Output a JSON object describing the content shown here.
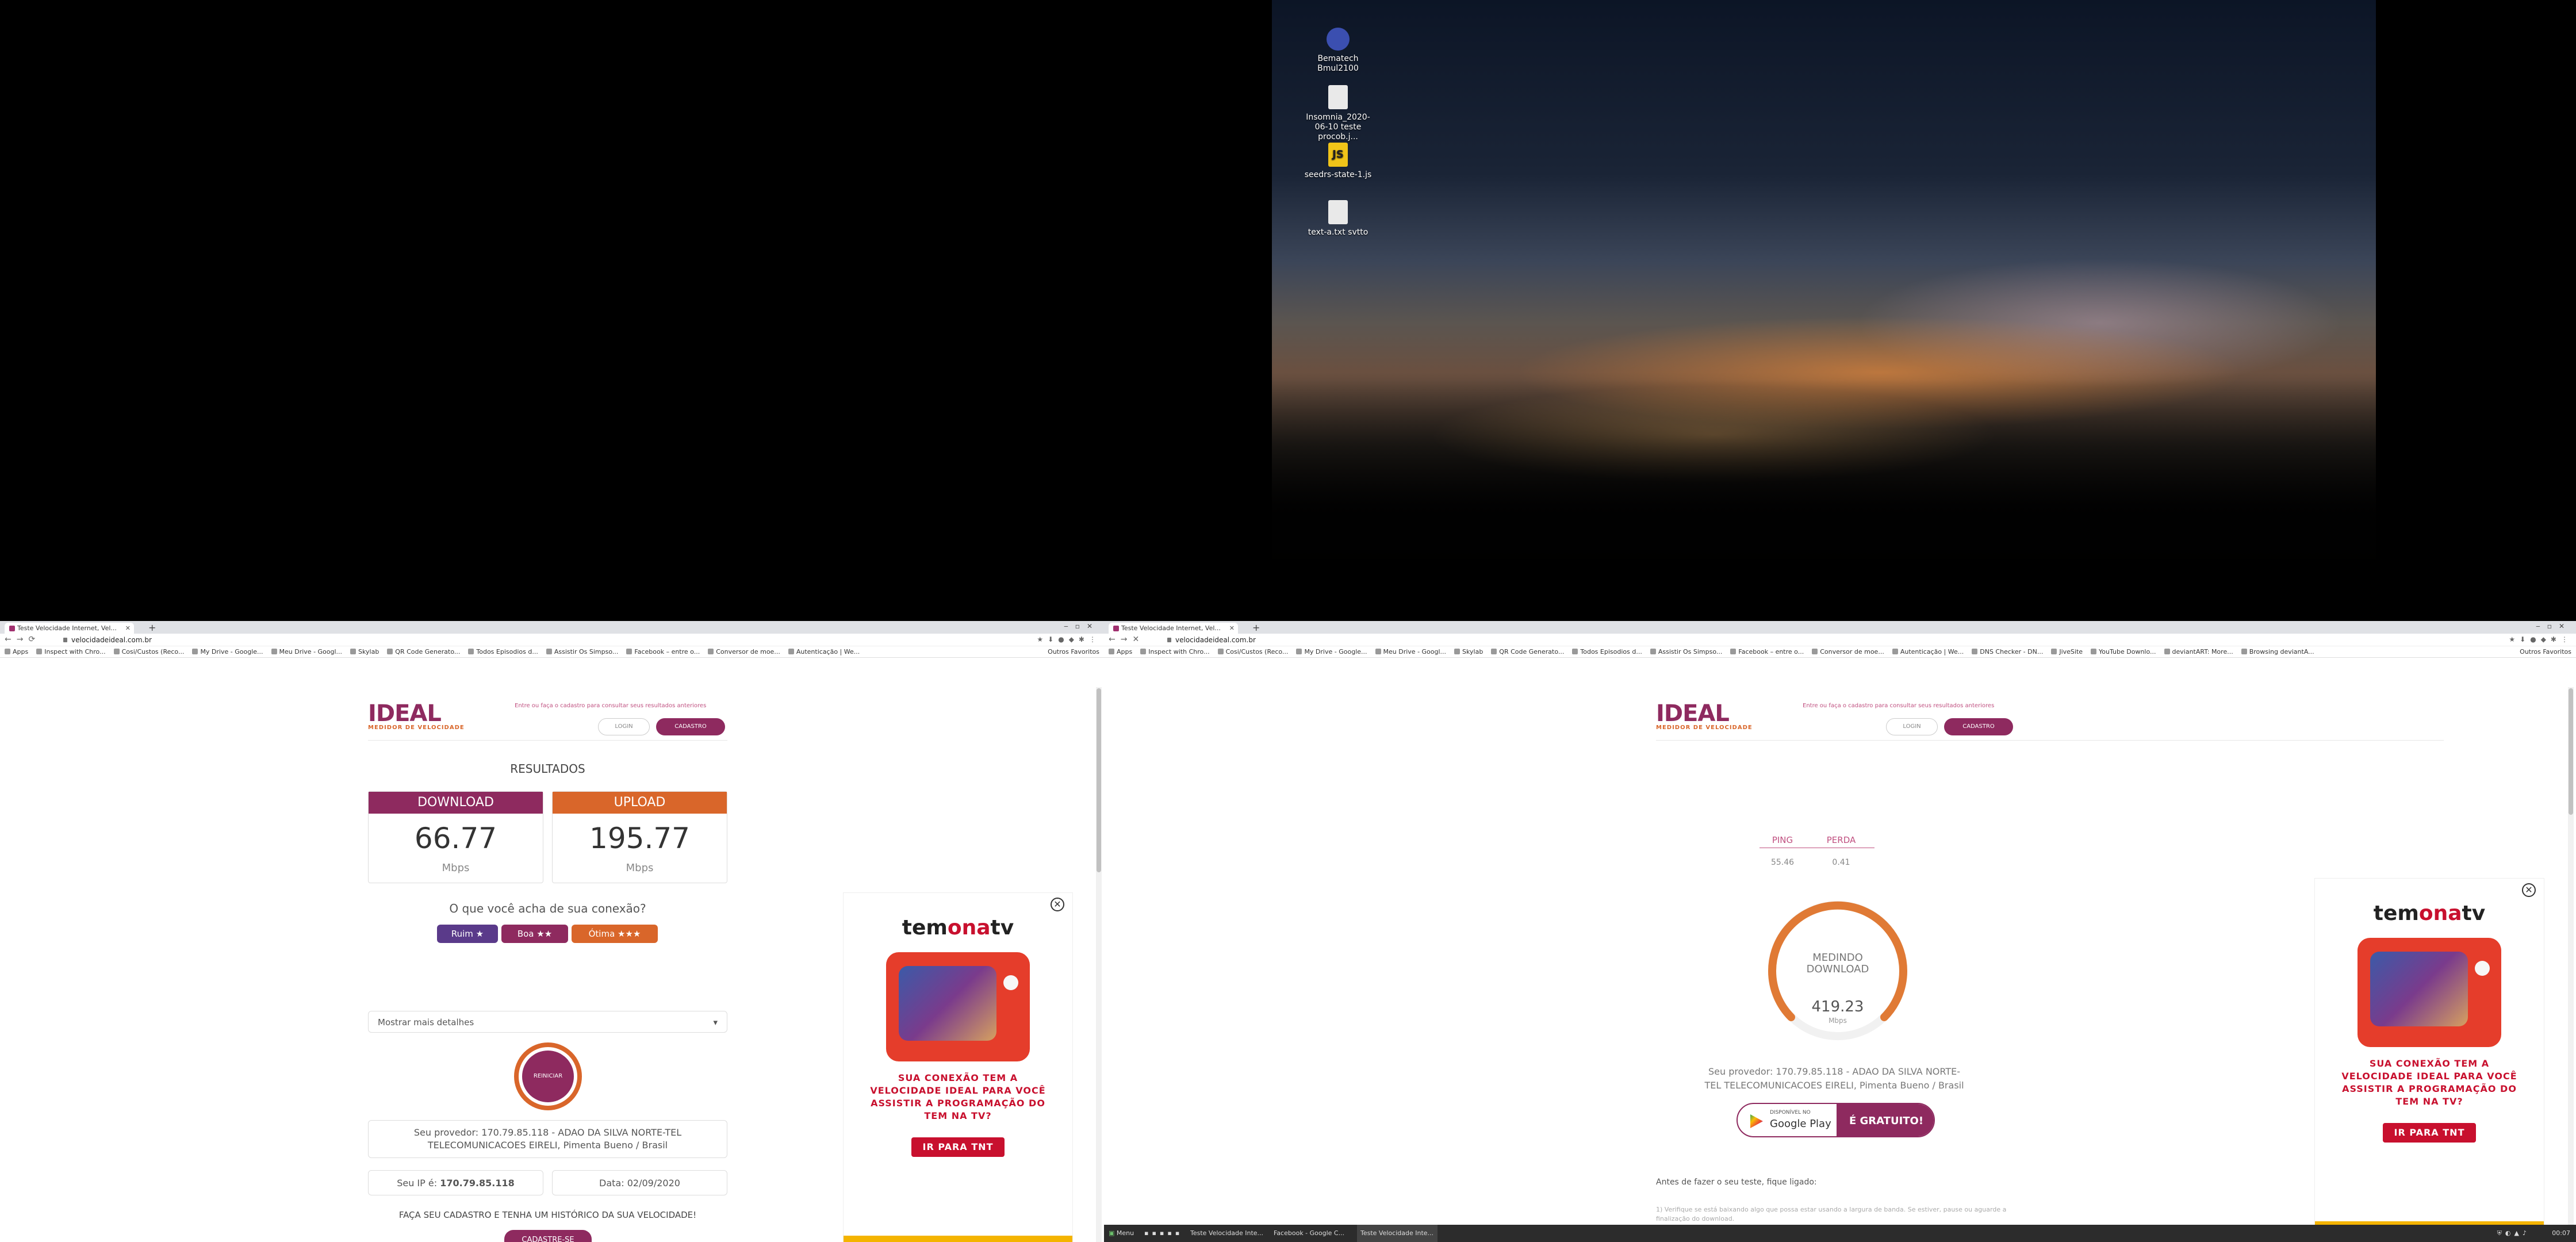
{
  "desktop": {
    "icons": [
      {
        "label": "Bematech Bmul2100",
        "glyph": "printer-icon"
      },
      {
        "label": "Insomnia_2020-06-10 teste procob.j...",
        "glyph": "file-icon"
      },
      {
        "label": "seedrs-state-1.js",
        "glyph": "js-file-icon"
      },
      {
        "label": "text-a.txt svtto",
        "glyph": "text-file-icon"
      }
    ]
  },
  "browser_left": {
    "tab_title": "Teste Velocidade Internet, Vel...",
    "url": "velocidadeideal.com.br",
    "bookmarks": [
      "Apps",
      "Inspect with Chro...",
      "Cosi/Custos (Reco...",
      "My Drive - Google...",
      "Meu Drive - Googl...",
      "Skylab",
      "QR Code Generato...",
      "Todos Episodios d...",
      "Assistir Os Simpso...",
      "Facebook – entre o...",
      "Conversor de moe...",
      "Autenticação | We..."
    ],
    "other_bookmarks": "Outros Favoritos"
  },
  "browser_right": {
    "tab_title": "Teste Velocidade Internet, Vel...",
    "url": "velocidadeideal.com.br",
    "bookmarks": [
      "Apps",
      "Inspect with Chro...",
      "Cosi/Custos (Reco...",
      "My Drive - Google...",
      "Meu Drive - Googl...",
      "Skylab",
      "QR Code Generato...",
      "Todos Episodios d...",
      "Assistir Os Simpso...",
      "Facebook – entre o...",
      "Conversor de moe...",
      "Autenticação | We...",
      "DNS Checker - DN...",
      "JiveSite",
      "YouTube Downlo...",
      "deviantART: More...",
      "Browsing deviantA..."
    ],
    "other_bookmarks": "Outros Favoritos"
  },
  "site": {
    "logo": "IDEAL",
    "logo_sub": "MEDIDOR DE VELOCIDADE",
    "header_note": "Entre ou faça o cadastro para consultar seus resultados anteriores",
    "login": "LOGIN",
    "signup": "CADASTRO"
  },
  "results": {
    "title": "RESULTADOS",
    "download_label": "DOWNLOAD",
    "download_value": "66.77",
    "upload_label": "UPLOAD",
    "upload_value": "195.77",
    "unit": "Mbps",
    "question": "O que você acha de sua conexão?",
    "rate_bad": "Ruim ★",
    "rate_good": "Boa ★★",
    "rate_great": "Ótima ★★★",
    "details": "Mostrar mais detalhes",
    "restart": "REINICIAR",
    "provider": "Seu provedor: 170.79.85.118 - ADAO DA SILVA NORTE-TEL TELECOMUNICACOES EIRELI, Pimenta Bueno / Brasil",
    "ip_label": "Seu IP é:",
    "ip": "170.79.85.118",
    "date": "Data: 02/09/2020",
    "cta_text": "FAÇA SEU CADASTRO E TENHA UM HISTÓRICO DA SUA VELOCIDADE!",
    "cta_button": "CADASTRE-SE"
  },
  "measuring": {
    "ping_label": "PING",
    "ping_value": "55.46",
    "loss_label": "PERDA",
    "loss_value": "0.41",
    "status_line1": "MEDINDO",
    "status_line2": "DOWNLOAD",
    "speed": "419.23",
    "unit": "Mbps",
    "provider": "Seu provedor: 170.79.85.118 - ADAO DA SILVA NORTE-TEL TELECOMUNICACOES EIRELI, Pimenta Bueno / Brasil",
    "gplay_small": "DISPONÍVEL NO",
    "gplay": "Google Play",
    "free": "É GRATUITO!",
    "before_test": "Antes de fazer o seu teste, fique ligado:",
    "hint": "1) Verifique se está baixando algo que possa estar usando a largura de banda. Se estiver, pause ou aguarde a finalização do download."
  },
  "ad": {
    "brand_a": "tem",
    "brand_b": "ona",
    "brand_c": "tv",
    "message": "SUA CONEXÃO TEM A VELOCIDADE IDEAL PARA VOCÊ ASSISTIR A PROGRAMAÇÃO DO TEM NA TV?",
    "button": "IR PARA TNT"
  },
  "taskbar": {
    "menu": "Menu",
    "windows": [
      "Teste Velocidade Inte...",
      "Facebook - Google C...",
      "Teste Velocidade Inte..."
    ],
    "clock": "00:07"
  }
}
